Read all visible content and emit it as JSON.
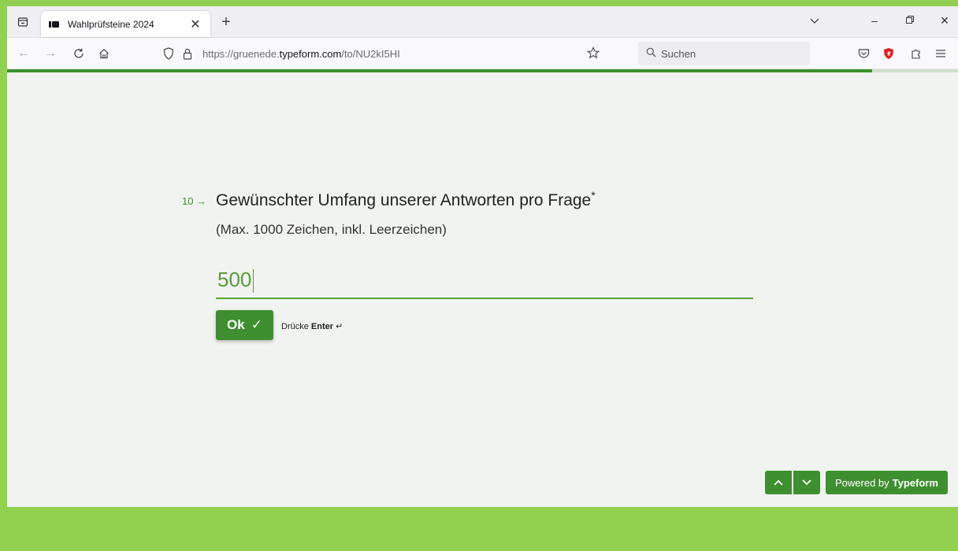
{
  "browser": {
    "tab": {
      "title": "Wahlprüfsteine 2024"
    },
    "new_tab_label": "+",
    "url": {
      "prefix": "https://gruenede.",
      "domain": "typeform.com",
      "path": "/to/NU2kI5HI"
    },
    "search_placeholder": "Suchen",
    "accent_shield_color": "#e02020"
  },
  "progress": {
    "fraction": 0.91,
    "color": "#3e8f2f"
  },
  "question": {
    "number": "10",
    "arrow": "→",
    "title": "Gewünschter Umfang unserer Antworten pro Frage",
    "required_mark": "*",
    "description": "(Max. 1000 Zeichen, inkl. Leerzeichen)"
  },
  "answer": {
    "value": "500"
  },
  "ok_button": {
    "label": "Ok",
    "check": "✓"
  },
  "enter_hint": {
    "prefix": "Drücke",
    "key": "Enter",
    "symbol": "↵"
  },
  "footer": {
    "powered_prefix": "Powered by",
    "powered_brand": "Typeform"
  },
  "colors": {
    "accent": "#3e8f2f",
    "page_frame": "#92d050",
    "form_bg": "#f1f3f0"
  }
}
